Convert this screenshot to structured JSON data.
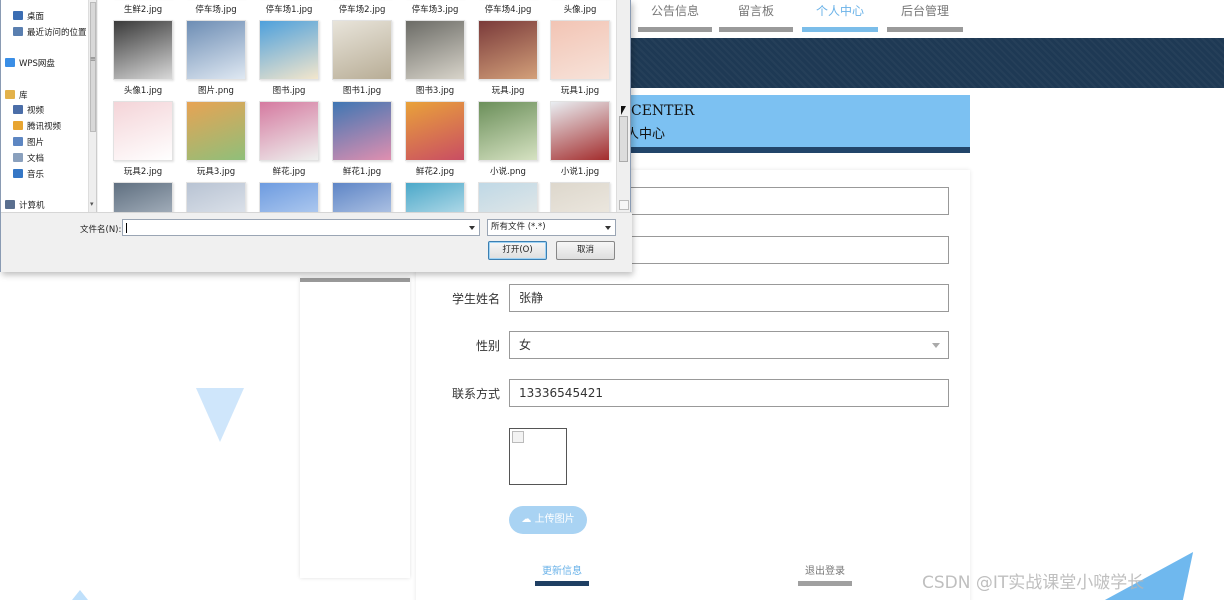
{
  "nav": {
    "items": [
      {
        "label": "公告信息",
        "active": false
      },
      {
        "label": "留言板",
        "active": false
      },
      {
        "label": "个人中心",
        "active": true
      },
      {
        "label": "后台管理",
        "active": false
      }
    ]
  },
  "center": {
    "title_en": "CENTER",
    "title_cn": "人中心"
  },
  "form": {
    "name_label": "学生姓名",
    "name_value": "张静",
    "gender_label": "性别",
    "gender_value": "女",
    "phone_label": "联系方式",
    "phone_value": "13336545421",
    "upload_label": "上传图片",
    "update_label": "更新信息",
    "logout_label": "退出登录"
  },
  "watermark": "CSDN @IT实战课堂小啵学长",
  "dialog": {
    "sidebar": [
      {
        "label": "桌面",
        "icon": "desktop-icon",
        "color": "#3b6db3"
      },
      {
        "label": "最近访问的位置",
        "icon": "recent-icon",
        "color": "#5a7fb0"
      },
      {
        "label": "WPS网盘",
        "icon": "cloud-icon",
        "color": "#3a8ee6",
        "root": true
      },
      {
        "label": "库",
        "icon": "library-icon",
        "color": "#e3b24b",
        "root": true
      },
      {
        "label": "视频",
        "icon": "video-icon",
        "color": "#4b6ea8"
      },
      {
        "label": "腾讯视频",
        "icon": "tencent-video-icon",
        "color": "#e8a531"
      },
      {
        "label": "图片",
        "icon": "pictures-icon",
        "color": "#5d86c2"
      },
      {
        "label": "文档",
        "icon": "documents-icon",
        "color": "#8aa0bd"
      },
      {
        "label": "音乐",
        "icon": "music-icon",
        "color": "#3577c6"
      },
      {
        "label": "计算机",
        "icon": "computer-icon",
        "color": "#5a6f8f",
        "root": true
      }
    ],
    "files": [
      {
        "name": "生鲜2.jpg",
        "colors": [
          "#b8a88e",
          "#d9cdb8"
        ]
      },
      {
        "name": "停车场.jpg",
        "colors": [
          "#7d8a96",
          "#b5bec6"
        ]
      },
      {
        "name": "停车场1.jpg",
        "colors": [
          "#8c96a0",
          "#c3c9ce"
        ]
      },
      {
        "name": "停车场2.jpg",
        "colors": [
          "#838b91",
          "#bcc2c6"
        ]
      },
      {
        "name": "停车场3.jpg",
        "colors": [
          "#8e949b",
          "#c8cccf"
        ]
      },
      {
        "name": "停车场4.jpg",
        "colors": [
          "#7e878d",
          "#b9bec2"
        ]
      },
      {
        "name": "头像.jpg",
        "colors": [
          "#c9b6a6",
          "#e9dcd2"
        ]
      },
      {
        "name": "头像1.jpg",
        "colors": [
          "#3a3a3a",
          "#d8d8d8"
        ]
      },
      {
        "name": "图片.png",
        "colors": [
          "#6d8db4",
          "#dfe8f2"
        ]
      },
      {
        "name": "图书.jpg",
        "colors": [
          "#4ea0dc",
          "#f3e6cc"
        ]
      },
      {
        "name": "图书1.jpg",
        "colors": [
          "#e8e4da",
          "#b8ad96"
        ]
      },
      {
        "name": "图书3.jpg",
        "colors": [
          "#6b6b66",
          "#d8d4ca"
        ]
      },
      {
        "name": "玩具.jpg",
        "colors": [
          "#7a3a3a",
          "#d3a07a"
        ]
      },
      {
        "name": "玩具1.jpg",
        "colors": [
          "#f2c4b4",
          "#f7e3da"
        ]
      },
      {
        "name": "玩具2.jpg",
        "colors": [
          "#f4d4d8",
          "#ffffff"
        ]
      },
      {
        "name": "玩具3.jpg",
        "colors": [
          "#e7a354",
          "#8fbf7a"
        ]
      },
      {
        "name": "鲜花.jpg",
        "colors": [
          "#d57aa0",
          "#eef0ee"
        ]
      },
      {
        "name": "鲜花1.jpg",
        "colors": [
          "#3f76b3",
          "#e08fb0"
        ]
      },
      {
        "name": "鲜花2.jpg",
        "colors": [
          "#e9a23a",
          "#c94d63"
        ]
      },
      {
        "name": "小说.png",
        "colors": [
          "#6b8f5a",
          "#d6e2c2"
        ]
      },
      {
        "name": "小说1.jpg",
        "colors": [
          "#e9eef2",
          "#a32c2c"
        ]
      },
      {
        "name": "",
        "colors": [
          "#5f6f80",
          "#c5ced8"
        ]
      },
      {
        "name": "",
        "colors": [
          "#b8c3d3",
          "#eef1f5"
        ]
      },
      {
        "name": "",
        "colors": [
          "#6d9be0",
          "#cfe0f6"
        ]
      },
      {
        "name": "",
        "colors": [
          "#5e85c6",
          "#d6e1f2"
        ]
      },
      {
        "name": "",
        "colors": [
          "#4ba8c9",
          "#e5f2f7"
        ]
      },
      {
        "name": "",
        "colors": [
          "#bfd8e6",
          "#f1eee8"
        ]
      },
      {
        "name": "",
        "colors": [
          "#ddd7cc",
          "#f3efe8"
        ]
      }
    ],
    "filename_label": "文件名(N):",
    "filename_value": "",
    "filetype_value": "所有文件 (*.*)",
    "open_label": "打开(O)",
    "cancel_label": "取消"
  }
}
